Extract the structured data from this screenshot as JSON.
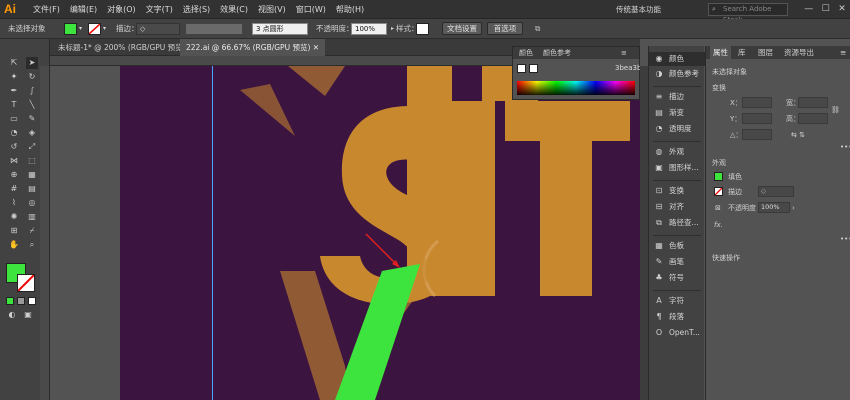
{
  "app": {
    "logo": "Ai"
  },
  "menu": [
    "文件(F)",
    "编辑(E)",
    "对象(O)",
    "文字(T)",
    "选择(S)",
    "效果(C)",
    "视图(V)",
    "窗口(W)",
    "帮助(H)"
  ],
  "workspace": {
    "label": "传统基本功能",
    "search_placeholder": "Search Adobe Stock"
  },
  "control_bar": {
    "selection_label": "未选择对象",
    "stroke_label": "描边：",
    "brush_value": "3 点圆形",
    "opacity_label": "不透明度：",
    "opacity_value": "100%",
    "style_label": "样式：",
    "doc_setup_button": "文档设置",
    "preferences_button": "首选项",
    "fill_color": "#3ee43e"
  },
  "tabs": [
    {
      "label": "未标题-1* @ 200% (RGB/GPU 预览)",
      "active": false
    },
    {
      "label": "222.ai @ 66.67% (RGB/GPU 预览)",
      "active": true
    }
  ],
  "color_panel": {
    "tab1": "颜色",
    "tab2": "颜色参考",
    "hex": "3bea3b"
  },
  "dock": [
    {
      "icon": "palette-icon",
      "label": "颜色"
    },
    {
      "icon": "color-guide-icon",
      "label": "颜色参考"
    },
    {
      "icon": "stroke-icon",
      "label": "描边"
    },
    {
      "icon": "gradient-icon",
      "label": "渐变"
    },
    {
      "icon": "transparency-icon",
      "label": "透明度"
    },
    {
      "icon": "appearance-icon",
      "label": "外观"
    },
    {
      "icon": "graphic-styles-icon",
      "label": "图形样..."
    },
    {
      "icon": "transform-icon",
      "label": "变换"
    },
    {
      "icon": "align-icon",
      "label": "对齐"
    },
    {
      "icon": "pathfinder-icon",
      "label": "路径查..."
    },
    {
      "icon": "swatches-icon",
      "label": "色板"
    },
    {
      "icon": "brushes-icon",
      "label": "画笔"
    },
    {
      "icon": "symbols-icon",
      "label": "符号"
    },
    {
      "icon": "character-icon",
      "label": "字符"
    },
    {
      "icon": "paragraph-icon",
      "label": "段落"
    },
    {
      "icon": "opentype-icon",
      "label": "OpenT..."
    }
  ],
  "properties": {
    "tabs": [
      "属性",
      "库",
      "图层",
      "资源导出"
    ],
    "no_selection": "未选择对象",
    "transform_title": "变换",
    "x_label": "X：",
    "y_label": "Y：",
    "w_label": "宽：",
    "h_label": "高：",
    "angle_label": "△：",
    "appearance_title": "外观",
    "fill_label": "填色",
    "stroke_label": "描边",
    "opacity_label": "不透明度",
    "opacity_value": "100%",
    "fx_label": "fx.",
    "quick_actions_title": "快速操作"
  },
  "artwork": {
    "background": "#3c1440",
    "letter_color": "#c8892e",
    "shape_color": "#3ee43e",
    "arrow_color": "#e02020"
  }
}
